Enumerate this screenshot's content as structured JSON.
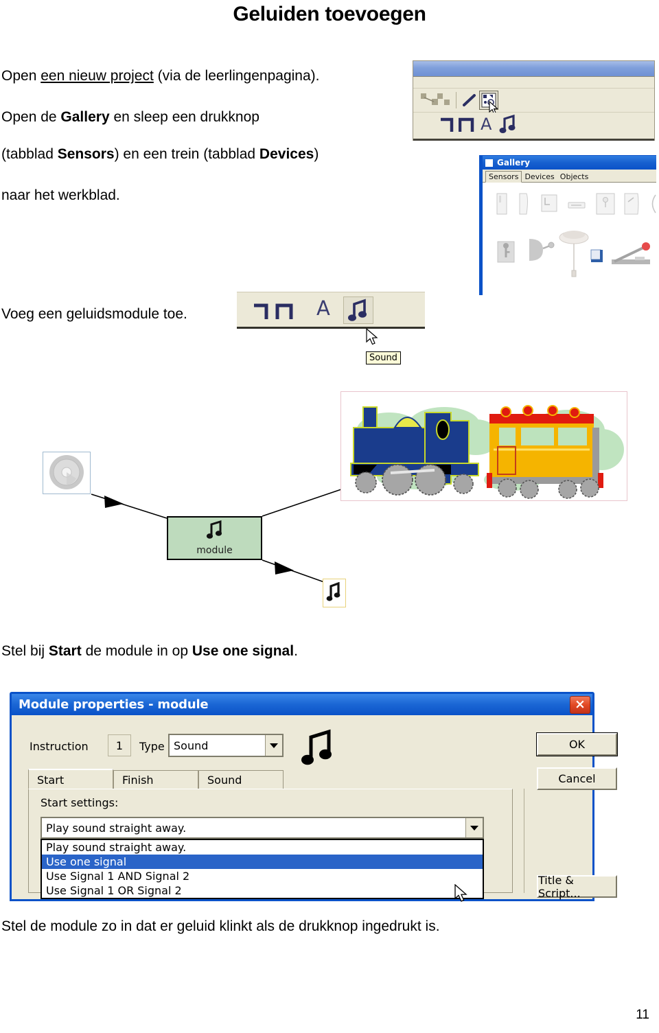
{
  "page": {
    "title": "Geluiden toevoegen",
    "number": "11"
  },
  "instructions": {
    "line1_prefix": "Open ",
    "line1_underline": "een nieuw project",
    "line1_suffix": " (via de leerlingenpagina).",
    "line2_a": "Open de ",
    "line2_bold": "Gallery",
    "line2_b": " en sleep een drukknop",
    "line3_a": "(tabblad ",
    "line3_bold1": "Sensors",
    "line3_b": ") en een trein (tabblad ",
    "line3_bold2": "Devices",
    "line3_c": ")",
    "line4": "naar het werkblad.",
    "line5": "Voeg een geluidsmodule toe.",
    "line6_a": "Stel bij ",
    "line6_bold1": "Start",
    "line6_b": " de module in op ",
    "line6_bold2": "Use one signal",
    "line6_c": ".",
    "line7": "Stel de module zo in dat er geluid klinkt als de drukknop ingedrukt is."
  },
  "toolbar": {
    "icons": [
      "connect-icon",
      "pencil-icon",
      "gallery-icon"
    ],
    "module_glyphs": [
      "delay-glyph",
      "pulse-glyph",
      "text-glyph",
      "sound-glyph"
    ]
  },
  "gallery": {
    "title": "Gallery",
    "tabs": [
      {
        "label": "Sensors",
        "selected": true
      },
      {
        "label": "Devices",
        "selected": false
      },
      {
        "label": "Objects",
        "selected": false
      }
    ]
  },
  "sound_toolbar": {
    "glyphs": [
      "delay-glyph",
      "pulse-glyph",
      "text-glyph",
      "sound-glyph"
    ],
    "tooltip": "Sound"
  },
  "workspace": {
    "module_label": "module",
    "nodes": [
      "pushbutton-node",
      "module-node",
      "sound-node",
      "train-node"
    ]
  },
  "dialog": {
    "title": "Module properties - module",
    "close_label": "×",
    "instruction_label": "Instruction",
    "instruction_value": "1",
    "type_label": "Type",
    "type_value": "Sound",
    "tabs": [
      {
        "label": "Start",
        "selected": true
      },
      {
        "label": "Finish",
        "selected": false
      },
      {
        "label": "Sound",
        "selected": false
      }
    ],
    "start_settings_label": "Start settings:",
    "start_combo_value": "Play sound straight away.",
    "dropdown_options": [
      {
        "label": "Play sound straight away.",
        "selected": false
      },
      {
        "label": "Use one signal",
        "selected": true
      },
      {
        "label": "Use Signal 1 AND Signal 2",
        "selected": false
      },
      {
        "label": "Use Signal 1 OR  Signal 2",
        "selected": false
      }
    ],
    "ok_label": "OK",
    "cancel_label": "Cancel",
    "title_script_label": "Title & Script..."
  },
  "colors": {
    "window_chrome": "#ece9d8",
    "title_blue": "#0a52c8",
    "selection_blue": "#2a64c8",
    "module_green": "#bedbbd",
    "glyph_navy": "#2a2d62",
    "train_body_blue": "#1a3c8c",
    "train_carriage_yellow": "#f5b400",
    "train_roof_red": "#e01b10",
    "close_red": "#e24a24"
  }
}
